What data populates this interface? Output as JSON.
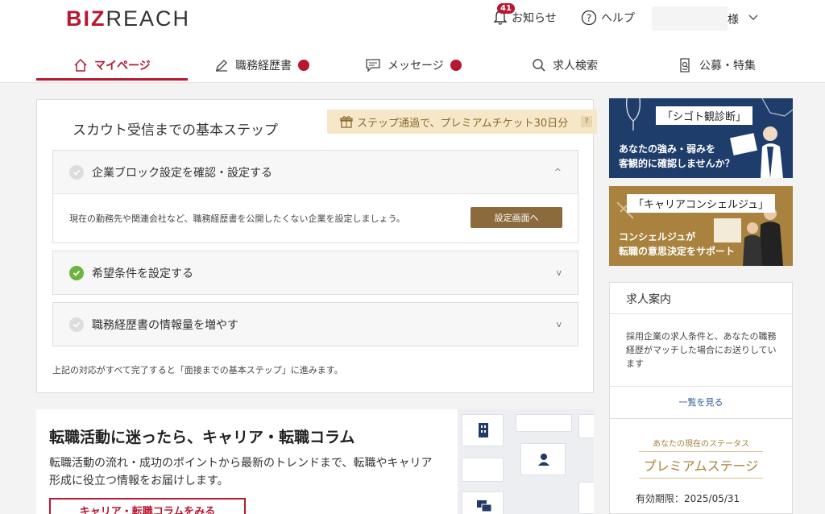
{
  "header": {
    "logo": {
      "biz": "BIZ",
      "reach": "REACH"
    },
    "notifications": {
      "label": "お知らせ",
      "count": "41"
    },
    "help": {
      "label": "ヘルプ"
    },
    "user": {
      "suffix": "様"
    }
  },
  "nav": {
    "items": [
      {
        "label": "マイページ"
      },
      {
        "label": "職務経歴書"
      },
      {
        "label": "メッセージ"
      },
      {
        "label": "求人検索"
      },
      {
        "label": "公募・特集"
      }
    ]
  },
  "steps": {
    "title": "スカウト受信までの基本ステップ",
    "ribbon": "ステップ通過で、プレミアムチケット30日分",
    "ribbon_help": "?",
    "items": [
      {
        "label": "企業ブロック設定を確認・設定する",
        "body": "現在の勤務先や関連会社など、職務経歴書を公開したくない企業を設定しましょう。",
        "button": "設定画面へ",
        "chevron": "^"
      },
      {
        "label": "希望条件を設定する",
        "chevron": "v"
      },
      {
        "label": "職務経歴書の情報量を増やす",
        "chevron": "v"
      }
    ],
    "note": "上記の対応がすべて完了すると「面接までの基本ステップ」に進みます。"
  },
  "column": {
    "title": "転職活動に迷ったら、キャリア・転職コラム",
    "text": "転職活動の流れ・成功のポイントから最新のトレンドまで、転職やキャリア形成に役立つ情報をお届けします。",
    "button": "キャリア・転職コラムをみる"
  },
  "banners": {
    "diagnosis": {
      "head": "「シゴト観診断」",
      "line1": "あなたの強み・弱みを",
      "line2": "客観的に確認しませんか？"
    },
    "concierge": {
      "head": "「キャリアコンシェルジュ」",
      "line1": "コンシェルジュが",
      "line2": "転職の意思決定をサポート"
    }
  },
  "jobs": {
    "title": "求人案内",
    "text": "採用企業の求人条件と、あなたの職務経歴がマッチした場合にお送りしています",
    "link": "一覧を見る"
  },
  "status": {
    "label": "あなたの現在のステータス",
    "stage": "プレミアムステージ",
    "expiry": "有効期限：2025/05/31"
  },
  "colors": {
    "accent": "#b8182f",
    "brown": "#8b6a3c",
    "check": "#6db33f"
  }
}
